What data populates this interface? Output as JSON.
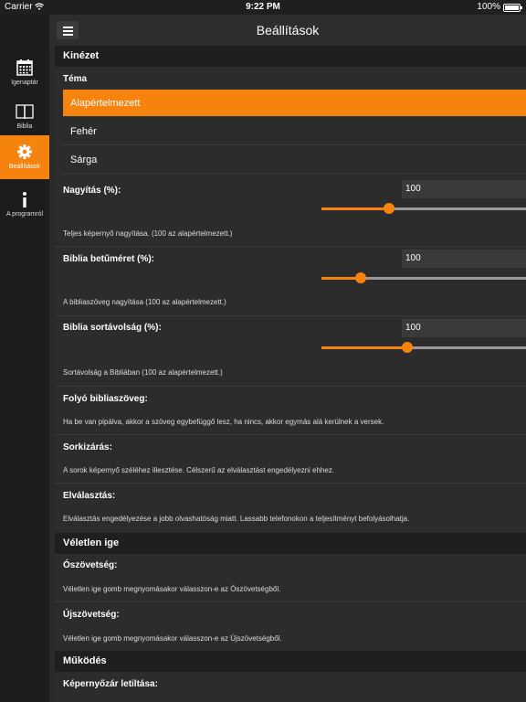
{
  "status": {
    "carrier": "Carrier",
    "time": "9:22 PM",
    "battery": "100%"
  },
  "header": {
    "title": "Beállítások"
  },
  "sidebar": {
    "items": [
      {
        "label": "Igenaptár",
        "icon": "calendar-icon"
      },
      {
        "label": "Biblia",
        "icon": "book-icon"
      },
      {
        "label": "Beállítások",
        "icon": "gear-icon",
        "active": true
      },
      {
        "label": "A programról",
        "icon": "info-icon"
      }
    ]
  },
  "sections": {
    "appearance": "Kinézet",
    "random": "Véletlen ige",
    "behavior": "Működés"
  },
  "theme": {
    "label": "Téma",
    "options": [
      "Alapértelmezett",
      "Fehér",
      "Sárga"
    ],
    "selected": "Alapértelmezett"
  },
  "zoom": {
    "label": "Nagyítás (%):",
    "value": "100",
    "level": 0.33,
    "desc": "Teljes képernyő nagyítása. (100 az alapértelmezett.)"
  },
  "fontsize": {
    "label": "Biblia betűméret (%):",
    "value": "100",
    "level": 0.19,
    "desc": "A bibliaszöveg nagyítása (100 az alapértelmezett.)"
  },
  "linespacing": {
    "label": "Biblia sortávolság (%):",
    "value": "100",
    "level": 0.42,
    "desc": "Sortávolság a Bibliában (100 az alapértelmezett.)"
  },
  "flowing": {
    "label": "Folyó bibliaszöveg:",
    "desc": "Ha be van pipálva, akkor a szöveg egybefüggő lesz, ha nincs, akkor egymás alá kerülnek a versek."
  },
  "justify": {
    "label": "Sorkizárás:",
    "desc": "A sorok képernyő széléhez illesztése. Célszerű az elválasztást engedélyezni ehhez."
  },
  "hyphen": {
    "label": "Elválasztás:",
    "desc": "Elválasztás engedélyezése a jobb olvashatóság miatt. Lassabb telefonokon a teljesítményt befolyásolhatja."
  },
  "ot": {
    "label": "Ószövetség:",
    "desc": "Véletlen ige gomb megnyomásakor válasszon-e az Ószövetségből."
  },
  "nt": {
    "label": "Újszövetség:",
    "desc": "Véletlen ige gomb megnyomásakor válasszon-e az Újszövetségből."
  },
  "lock": {
    "label": "Képernyőzár letiltása:"
  }
}
